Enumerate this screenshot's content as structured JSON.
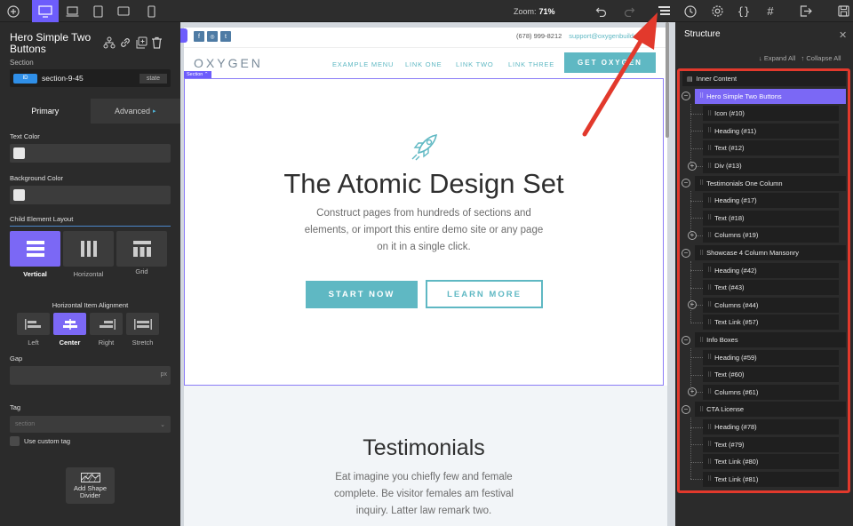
{
  "toolbar": {
    "zoom_label": "Zoom:",
    "zoom_value": "71%",
    "icons": [
      "add-icon",
      "desktop-icon",
      "laptop-icon",
      "tablet-icon",
      "tablet-landscape-icon",
      "phone-icon",
      "undo-icon",
      "redo-icon",
      "structure-icon",
      "history-icon",
      "settings-icon",
      "code-icon",
      "selector-icon",
      "exit-icon",
      "save-icon"
    ]
  },
  "left_panel": {
    "title": "Hero Simple Two Buttons",
    "subtitle": "Section",
    "id_badge": "ID",
    "id_value": "section-9-45",
    "state_label": "state",
    "tabs": {
      "primary": "Primary",
      "advanced": "Advanced"
    },
    "text_color_label": "Text Color",
    "bg_color_label": "Background Color",
    "child_layout_label": "Child Element Layout",
    "layout_options": [
      "Vertical",
      "Horizontal",
      "Grid"
    ],
    "align_title": "Horizontal Item Alignment",
    "align_options": [
      "Left",
      "Center",
      "Right",
      "Stretch"
    ],
    "gap_label": "Gap",
    "gap_unit": "px",
    "tag_label": "Tag",
    "tag_value": "section",
    "custom_tag_label": "Use custom tag",
    "shape_divider_label": "Add Shape Divider"
  },
  "page": {
    "social": [
      "f",
      "◎",
      "t"
    ],
    "phone": "(678) 999-8212",
    "email": "support@oxygenbuilder",
    "logo": "OXYGEN",
    "nav": [
      "EXAMPLE MENU",
      "LINK ONE",
      "LINK TWO",
      "LINK THREE"
    ],
    "cta": "GET OXYGEN",
    "section_tag": "Section",
    "hero_title": "The Atomic Design Set",
    "hero_text": "Construct pages from hundreds of sections and elements, or import this entire demo site or any page on it in a single click.",
    "btn_start": "START NOW",
    "btn_learn": "LEARN MORE",
    "testimonials_title": "Testimonials",
    "testimonials_text": "Eat imagine you chiefly few and female complete. Be visitor females am festival inquiry. Latter law remark two."
  },
  "structure": {
    "title": "Structure",
    "expand_all": "↓ Expand All",
    "collapse_all": "↑ Collapse All",
    "root": "Inner Content",
    "groups": [
      {
        "label": "Hero Simple Two Buttons",
        "children": [
          "Icon (#10)",
          "Heading (#11)",
          "Text (#12)",
          "Div (#13)"
        ]
      },
      {
        "label": "Testimonials One Column",
        "children": [
          "Heading (#17)",
          "Text (#18)",
          "Columns (#19)"
        ]
      },
      {
        "label": "Showcase 4 Column Mansonry",
        "children": [
          "Heading (#42)",
          "Text (#43)",
          "Columns (#44)",
          "Text Link (#57)"
        ]
      },
      {
        "label": "Info Boxes",
        "children": [
          "Heading (#59)",
          "Text (#60)",
          "Columns (#61)"
        ]
      },
      {
        "label": "CTA License",
        "children": [
          "Heading (#78)",
          "Text (#79)",
          "Text Link (#80)",
          "Text Link (#81)"
        ]
      }
    ]
  },
  "colors": {
    "accent": "#7b68f5",
    "teal": "#5fb8c3",
    "highlight": "#e2392c"
  }
}
